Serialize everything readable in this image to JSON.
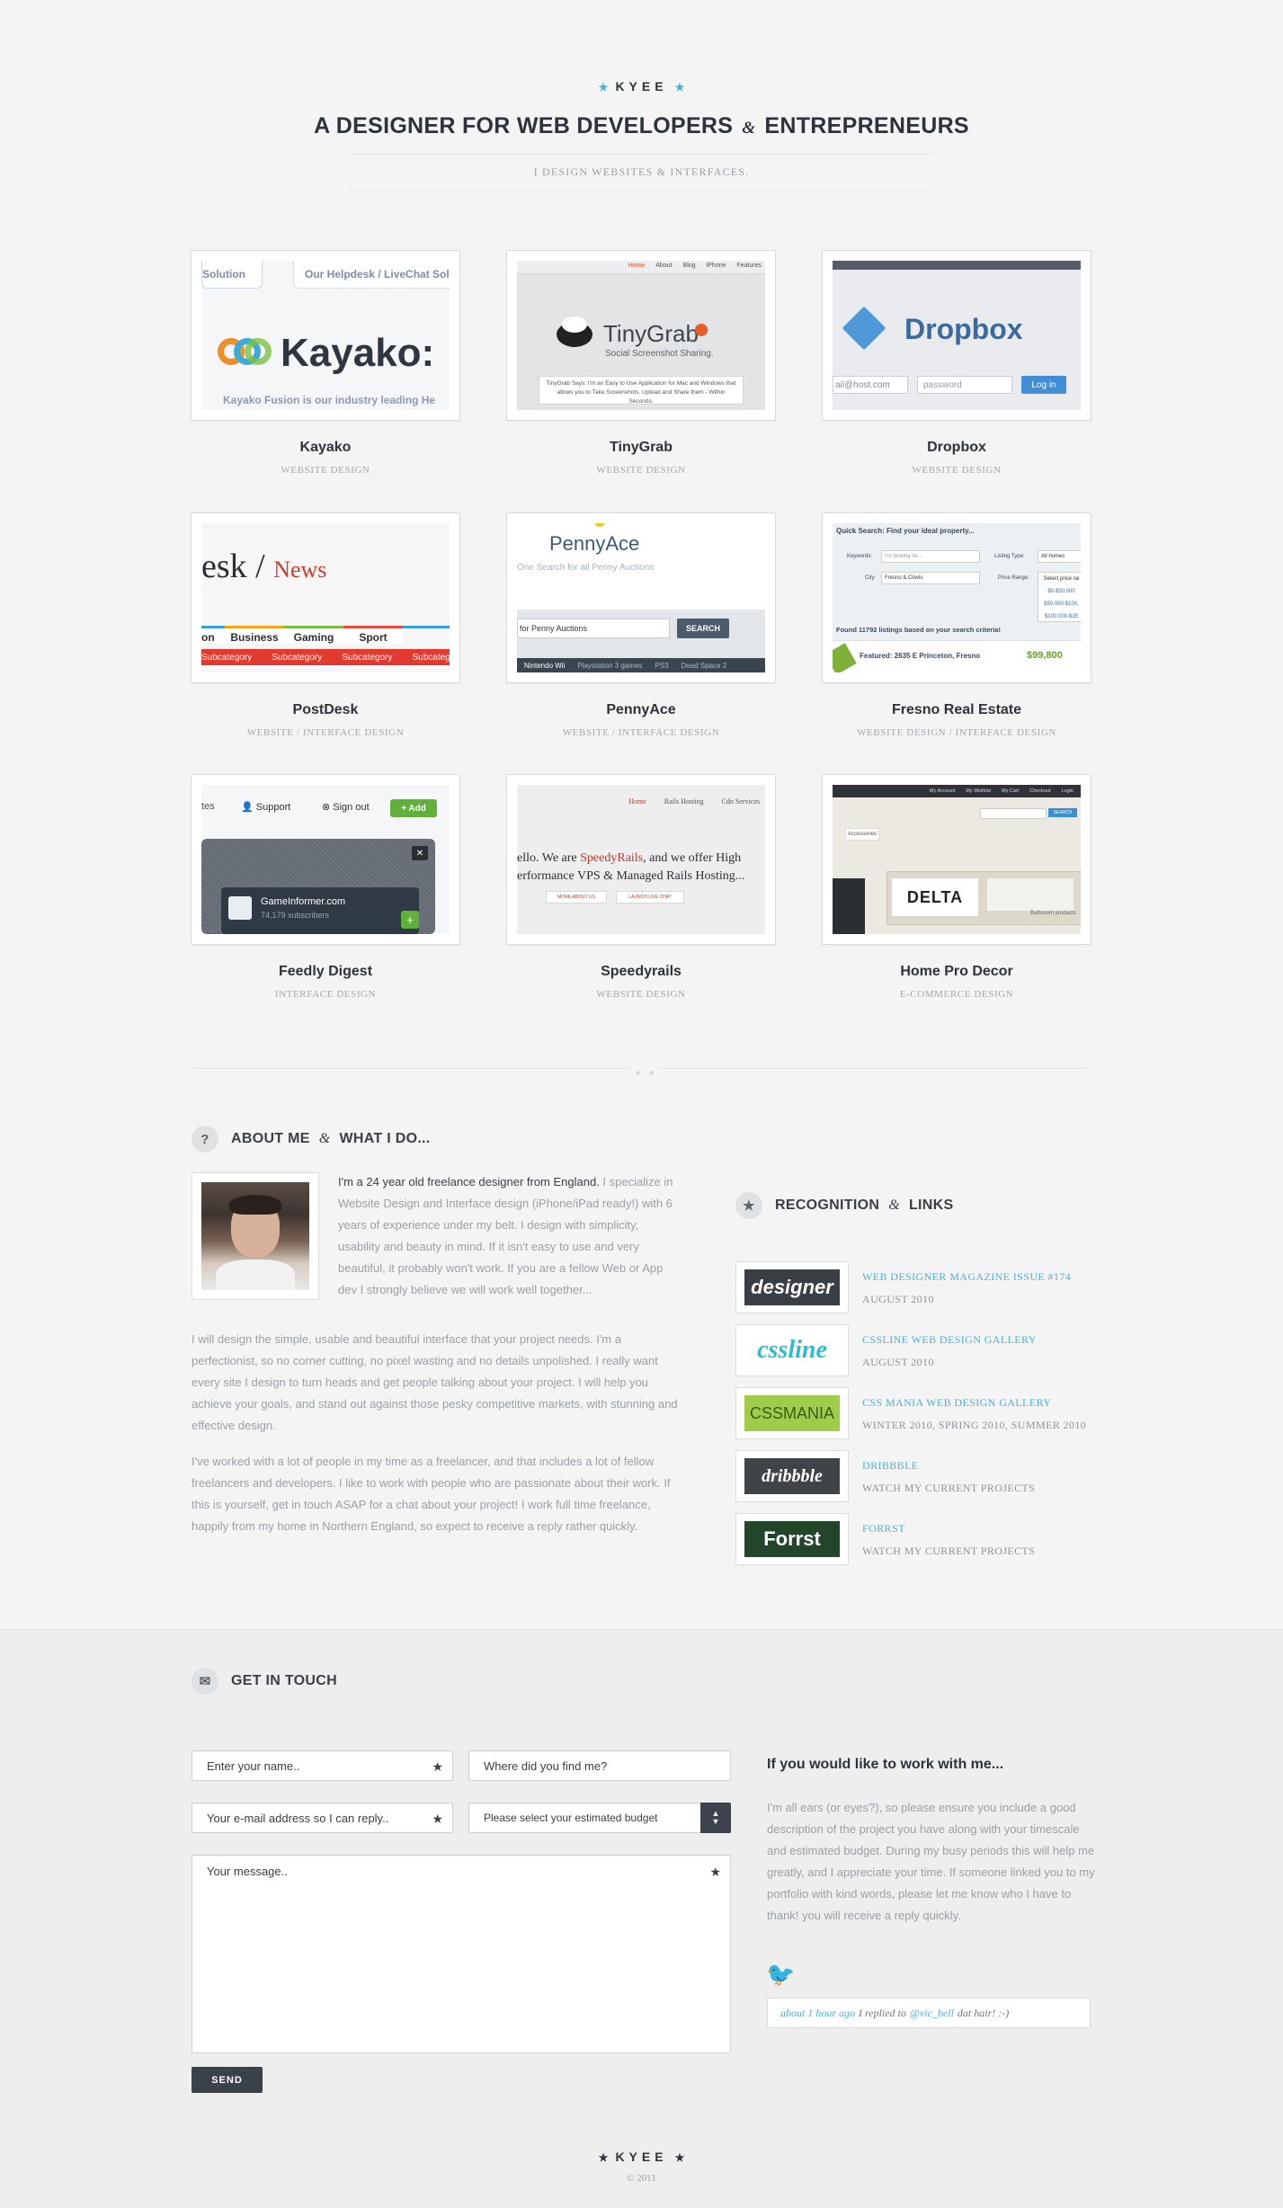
{
  "header": {
    "brand": "KYEE",
    "tagline_part1": "A DESIGNER FOR WEB DEVELOPERS",
    "tagline_amp": "&",
    "tagline_part2": "ENTREPRENEURS",
    "subtitle": "I design websites & interfaces."
  },
  "portfolio": [
    {
      "title": "Kayako",
      "category": "Website Design"
    },
    {
      "title": "TinyGrab",
      "category": "Website Design"
    },
    {
      "title": "Dropbox",
      "category": "Website Design"
    },
    {
      "title": "PostDesk",
      "category": "Website / Interface Design"
    },
    {
      "title": "PennyAce",
      "category": "Website / Interface Design"
    },
    {
      "title": "Fresno Real Estate",
      "category": "Website Design / Interface Design"
    },
    {
      "title": "Feedly Digest",
      "category": "Interface Design"
    },
    {
      "title": "Speedyrails",
      "category": "Website Design"
    },
    {
      "title": "Home Pro Decor",
      "category": "E-Commerce Design"
    }
  ],
  "shots": {
    "kayako": {
      "tab1": "Solution",
      "tab2": "Our Helpdesk / LiveChat Solu",
      "logo": "Kayako:",
      "tagline": "Kayako Fusion is our industry leading He"
    },
    "tinygrab": {
      "brand": "TinyGrab",
      "tag": "Social Screenshot Sharing.",
      "nav": [
        "Home",
        "About",
        "Blog",
        "iPhone",
        "Features"
      ],
      "blurb": "TinyGrab Says: I'm an Easy to Use Application for Mac and Windows that allows you to Take Screenshots, Upload and Share them - Within Seconds."
    },
    "dropbox": {
      "brand": "Dropbox",
      "email_ph": "ail@host.com",
      "pass_ph": "password",
      "login": "Log in"
    },
    "postdesk": {
      "brand_a": "esk /",
      "brand_b": "News",
      "tabs": [
        "on",
        "Business",
        "Gaming",
        "Sport"
      ],
      "sub": "Subcategory"
    },
    "pennyace": {
      "brand": "PennyAce",
      "tag": "One Search for all Penny Auctions",
      "search_ph": "for Penny Auctions",
      "search_btn": "SEARCH",
      "nav": [
        "Nintendo Wii",
        "Playstation 3 games",
        "PS3",
        "Dead Space 2"
      ]
    },
    "fresno": {
      "head": "Quick Search: Find your ideal property...",
      "keyword_label": "Keywords:",
      "keyword_ph": "I'm looking for...",
      "type_label": "Listing Type:",
      "type_val": "All homes",
      "city_label": "City:",
      "city_val": "Fresno & Clovis",
      "price_label": "Price Range:",
      "price_opts": [
        "Select price rai",
        "$0-$50,000",
        "$50,000-$100,",
        "$100,000-$15"
      ],
      "found": "Found 11792 listings based on your search criteria!",
      "featured": "Featured: 2635 E Princeton, Fresno",
      "price": "$99,800"
    },
    "feedly": {
      "tab": "tes",
      "support": "Support",
      "signout": "Sign out",
      "add": "+ Add",
      "site": "GameInformer.com",
      "subs": "74,179 subscribers"
    },
    "speedyrails": {
      "nav": [
        "Home",
        "Rails Hosting",
        "Cdn Services"
      ],
      "line1a": "ello. We are ",
      "line1b": "SpeedyRails",
      "line1c": ", and we offer High",
      "line2": "erformance VPS & Managed Rails Hosting...",
      "btn1": "MORE ABOUT US",
      "btn2": "LAUNCH LIVE CHAT"
    },
    "homepro": {
      "nav": [
        "My Account",
        "My Wishlist",
        "My Cart",
        "Checkout",
        "Login"
      ],
      "search_btn": "SEARCH",
      "menu": "Accessories",
      "delta": "DELTA",
      "caption": "Bathroom products"
    }
  },
  "about": {
    "heading_a": "ABOUT ME",
    "heading_amp": "&",
    "heading_b": "WHAT I DO...",
    "intro_lead": "I'm a 24 year old freelance designer from England.",
    "intro_rest": " I specialize in Website Design and Interface design (iPhone/iPad ready!) with 6 years of experience under my belt. I design with simplicity, usability and beauty in mind. If it isn't easy to use and very beautiful, it probably won't work. If you are a fellow Web or App dev I strongly believe we will work well together...",
    "p1": "I will design the simple, usable and beautiful interface that your project needs. I'm a perfectionist, so no corner cutting, no pixel wasting and no details unpolished. I really want every site I design to turn heads and get people talking about your project. I will help you achieve your goals, and stand out against those pesky competitive markets, with stunning and effective design.",
    "p2": "I've worked with a lot of people in my time as a freelancer, and that includes a lot of fellow freelancers and developers. I like to work with people who are passionate about their work. If this is yourself, get in touch ASAP for a chat about your project! I work full time freelance, happily from my home in Northern England, so expect to receive a reply rather quickly."
  },
  "recognition": {
    "heading_a": "RECOGNITION",
    "heading_amp": "&",
    "heading_b": "LINKS",
    "items": [
      {
        "logo": "designer",
        "link": "Web Designer Magazine Issue #174",
        "date": "August 2010"
      },
      {
        "logo": "cssline",
        "link": "CSSLine Web Design Gallery",
        "date": "August 2010"
      },
      {
        "logo": "CSSMANIA",
        "link": "CSS Mania Web Design Gallery",
        "date": "Winter 2010, Spring 2010, Summer 2010"
      },
      {
        "logo": "dribbble",
        "link": "Dribbble",
        "date": "Watch my current projects"
      },
      {
        "logo": "Forrst",
        "link": "Forrst",
        "date": "Watch my current projects"
      }
    ]
  },
  "contact": {
    "heading": "GET IN TOUCH",
    "name_ph": "Enter your name..",
    "source_ph": "Where did you find me?",
    "email_ph": "Your e-mail address so I can reply..",
    "budget_ph": "Please select your estimated budget",
    "message_ph": "Your message..",
    "send": "SEND",
    "work_title": "If you would like to work with me...",
    "work_text": "I'm all ears (or eyes?), so please ensure you include a good description of the project you have along with your timescale and estimated budget. During my busy periods this will help me greatly, and I appreciate your time. If someone linked you to my portfolio with kind words, please let me know who I have to thank! you will receive a reply quickly.",
    "tweet_time": "about 1 hour ago",
    "tweet_mid": "I replied to",
    "tweet_user": "@vic_bell",
    "tweet_text": "dat hair! :-)"
  },
  "footer": {
    "brand": "KYEE",
    "copyright": "© 2011"
  },
  "colors": {
    "accent": "#4fb0d3",
    "dark": "#3a414a",
    "bg": "#f4f4f4"
  }
}
